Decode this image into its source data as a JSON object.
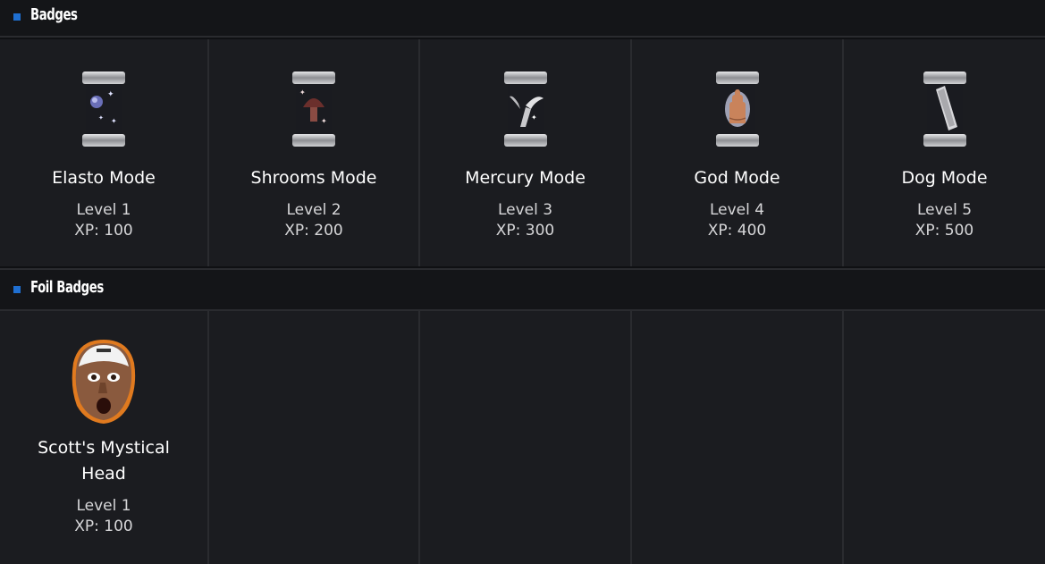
{
  "sections": [
    {
      "title": "Badges",
      "badges": [
        {
          "name": "Elasto Mode",
          "level": "Level 1",
          "xp": "XP: 100",
          "icon": "elasto-badge-icon"
        },
        {
          "name": "Shrooms Mode",
          "level": "Level 2",
          "xp": "XP: 200",
          "icon": "shrooms-badge-icon"
        },
        {
          "name": "Mercury Mode",
          "level": "Level 3",
          "xp": "XP: 300",
          "icon": "mercury-badge-icon"
        },
        {
          "name": "God Mode",
          "level": "Level 4",
          "xp": "XP: 400",
          "icon": "god-badge-icon"
        },
        {
          "name": "Dog Mode",
          "level": "Level 5",
          "xp": "XP: 500",
          "icon": "dog-badge-icon"
        }
      ]
    },
    {
      "title": "Foil Badges",
      "badges": [
        {
          "name": "Scott's Mystical Head",
          "level": "Level 1",
          "xp": "XP: 100",
          "icon": "scott-head-badge-icon"
        }
      ]
    }
  ],
  "colors": {
    "background": "#0f1013",
    "header": "#141518",
    "cell": "#1b1c20",
    "divider": "#2a2b2f",
    "accent": "#1f6fd1"
  }
}
